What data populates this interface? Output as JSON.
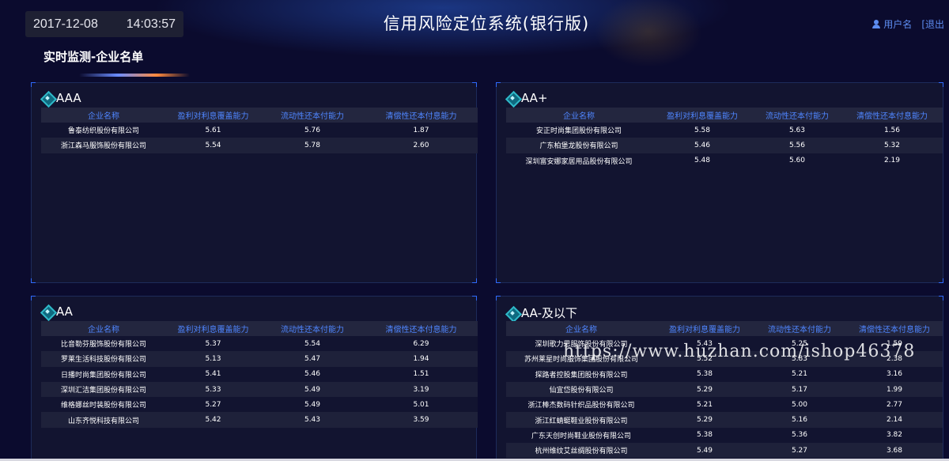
{
  "header": {
    "date": "2017-12-08",
    "time": "14:03:57",
    "title": "信用风险定位系统(银行版)",
    "user_label": "用户名",
    "logout_label": "[退出"
  },
  "section": {
    "title": "实时监测-企业名单"
  },
  "columns": [
    "企业名称",
    "盈利对利息覆盖能力",
    "流动性还本付能力",
    "清偿性还本付息能力"
  ],
  "panels": [
    {
      "grade": "AAA",
      "rows": [
        [
          "鲁泰纺织股份有限公司",
          "5.61",
          "5.76",
          "1.87"
        ],
        [
          "浙江森马服饰股份有限公司",
          "5.54",
          "5.78",
          "2.60"
        ]
      ]
    },
    {
      "grade": "AA+",
      "rows": [
        [
          "安正时尚集团股份有限公司",
          "5.58",
          "5.63",
          "1.56"
        ],
        [
          "广东柏堡龙股份有限公司",
          "5.46",
          "5.56",
          "5.32"
        ],
        [
          "深圳富安娜家居用品股份有限公司",
          "5.48",
          "5.60",
          "2.19"
        ]
      ]
    },
    {
      "grade": "AA",
      "rows": [
        [
          "比音勒芬服饰股份有限公司",
          "5.37",
          "5.54",
          "6.29"
        ],
        [
          "罗莱生活科技股份有限公司",
          "5.13",
          "5.47",
          "1.94"
        ],
        [
          "日播时尚集团股份有限公司",
          "5.41",
          "5.46",
          "1.51"
        ],
        [
          "深圳汇洁集团股份有限公司",
          "5.33",
          "5.49",
          "3.19"
        ],
        [
          "维格娜丝时装股份有限公司",
          "5.27",
          "5.49",
          "5.01"
        ],
        [
          "山东齐悦科技有限公司",
          "5.42",
          "5.43",
          "3.59"
        ]
      ]
    },
    {
      "grade": "AA-及以下",
      "rows": [
        [
          "深圳歌力思服饰股份有限公司",
          "5.43",
          "5.25",
          "1.59"
        ],
        [
          "苏州莱星时尚服饰集团股份有限公司",
          "5.52",
          "5.83",
          "2.38"
        ],
        [
          "探路者控股集团股份有限公司",
          "5.38",
          "5.21",
          "3.16"
        ],
        [
          "仙宜岱股份有限公司",
          "5.29",
          "5.17",
          "1.99"
        ],
        [
          "浙江棒杰数码针织品股份有限公司",
          "5.21",
          "5.00",
          "2.77"
        ],
        [
          "浙江红蜻蜓鞋业股份有限公司",
          "5.29",
          "5.16",
          "2.14"
        ],
        [
          "广东天创时尚鞋业股份有限公司",
          "5.38",
          "5.36",
          "3.82"
        ],
        [
          "杭州维纹艾丝绸股份有限公司",
          "5.49",
          "5.27",
          "3.68"
        ]
      ]
    }
  ],
  "watermark": "https://www.huzhan.com/ishop46378"
}
